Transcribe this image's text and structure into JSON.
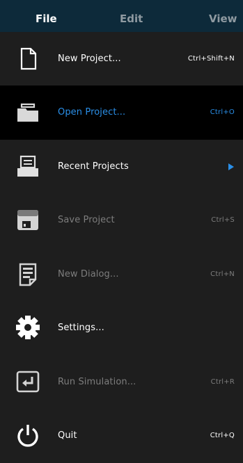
{
  "menubar": {
    "tabs": [
      {
        "label": "File"
      },
      {
        "label": "Edit"
      },
      {
        "label": "View"
      }
    ]
  },
  "menu": {
    "items": [
      {
        "label": "New Project...",
        "shortcut": "Ctrl+Shift+N",
        "icon": "new-file-icon",
        "state": "enabled"
      },
      {
        "label": "Open Project...",
        "shortcut": "Ctrl+O",
        "icon": "open-folder-icon",
        "state": "highlighted"
      },
      {
        "label": "Recent Projects",
        "shortcut": "",
        "icon": "recent-projects-icon",
        "state": "enabled",
        "submenu": true
      },
      {
        "label": "Save Project",
        "shortcut": "Ctrl+S",
        "icon": "save-icon",
        "state": "disabled"
      },
      {
        "label": "New Dialog...",
        "shortcut": "Ctrl+N",
        "icon": "new-dialog-icon",
        "state": "disabled"
      },
      {
        "label": "Settings...",
        "shortcut": "",
        "icon": "gear-icon",
        "state": "enabled"
      },
      {
        "label": "Run Simulation...",
        "shortcut": "Ctrl+R",
        "icon": "run-icon",
        "state": "disabled"
      },
      {
        "label": "Quit",
        "shortcut": "Ctrl+Q",
        "icon": "power-icon",
        "state": "enabled"
      }
    ]
  },
  "colors": {
    "menubar_bg": "#0d2a3a",
    "menu_bg": "#1e1e1e",
    "highlight_bg": "#000000",
    "accent": "#2a8fe8",
    "enabled_text": "#ffffff",
    "disabled_text": "#7d7d7d",
    "inactive_tab_text": "#8f9aa1"
  }
}
